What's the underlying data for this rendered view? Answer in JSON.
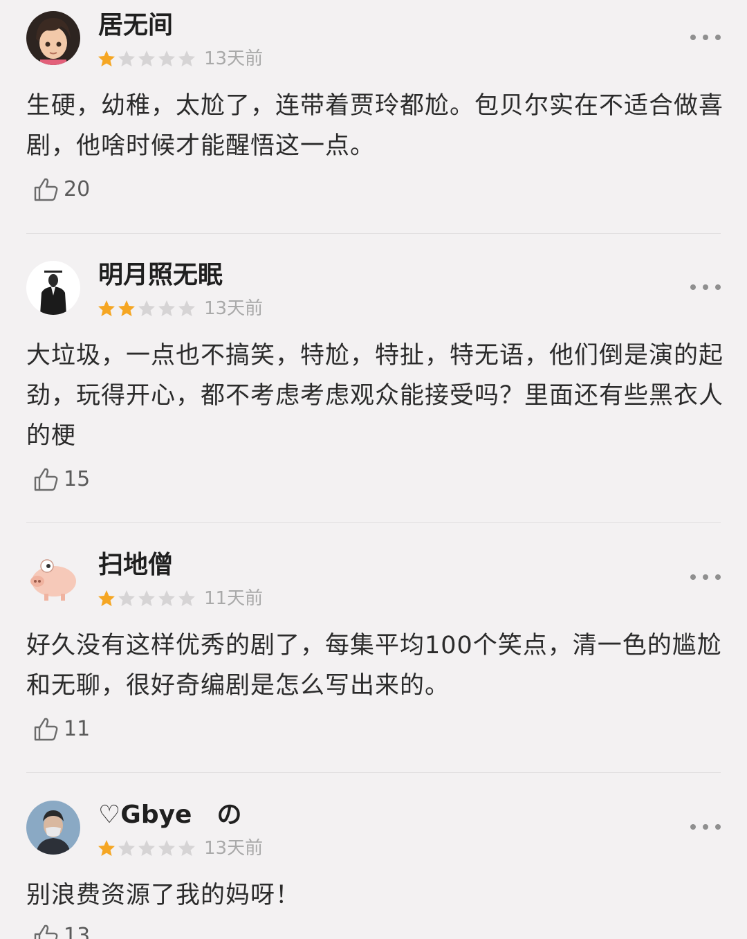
{
  "reviews": [
    {
      "user": "居无间",
      "rating": 1,
      "max_rating": 5,
      "time": "13天前",
      "text": "生硬，幼稚，太尬了，连带着贾玲都尬。包贝尔实在不适合做喜剧，他啥时候才能醒悟这一点。",
      "likes": "20",
      "avatar": "cartoon-girl-avatar"
    },
    {
      "user": "明月照无眠",
      "rating": 2,
      "max_rating": 5,
      "time": "13天前",
      "text": "大垃圾，一点也不搞笑，特尬，特扯，特无语，他们倒是演的起劲，玩得开心，都不考虑考虑观众能接受吗？里面还有些黑衣人的梗",
      "likes": "15",
      "avatar": "suited-man-avatar"
    },
    {
      "user": "扫地僧",
      "rating": 1,
      "max_rating": 5,
      "time": "11天前",
      "text": "好久没有这样优秀的剧了，每集平均100个笑点，清一色的尴尬和无聊，很好奇编剧是怎么写出来的。",
      "likes": "11",
      "avatar": "cartoon-pig-avatar"
    },
    {
      "user": "♡Gbye　の",
      "rating": 1,
      "max_rating": 5,
      "time": "13天前",
      "text": "别浪费资源了我的妈呀！",
      "likes": "13",
      "avatar": "masked-man-avatar"
    }
  ],
  "colors": {
    "background": "#f3f1f2",
    "star_filled": "#f5a623",
    "star_empty": "#d6d4d5",
    "time_text": "#a9a9a9",
    "divider": "#e1dfe0"
  },
  "icons": {
    "like": "thumbs-up-outline-icon",
    "more": "more-dots-icon",
    "star": "star-icon"
  }
}
